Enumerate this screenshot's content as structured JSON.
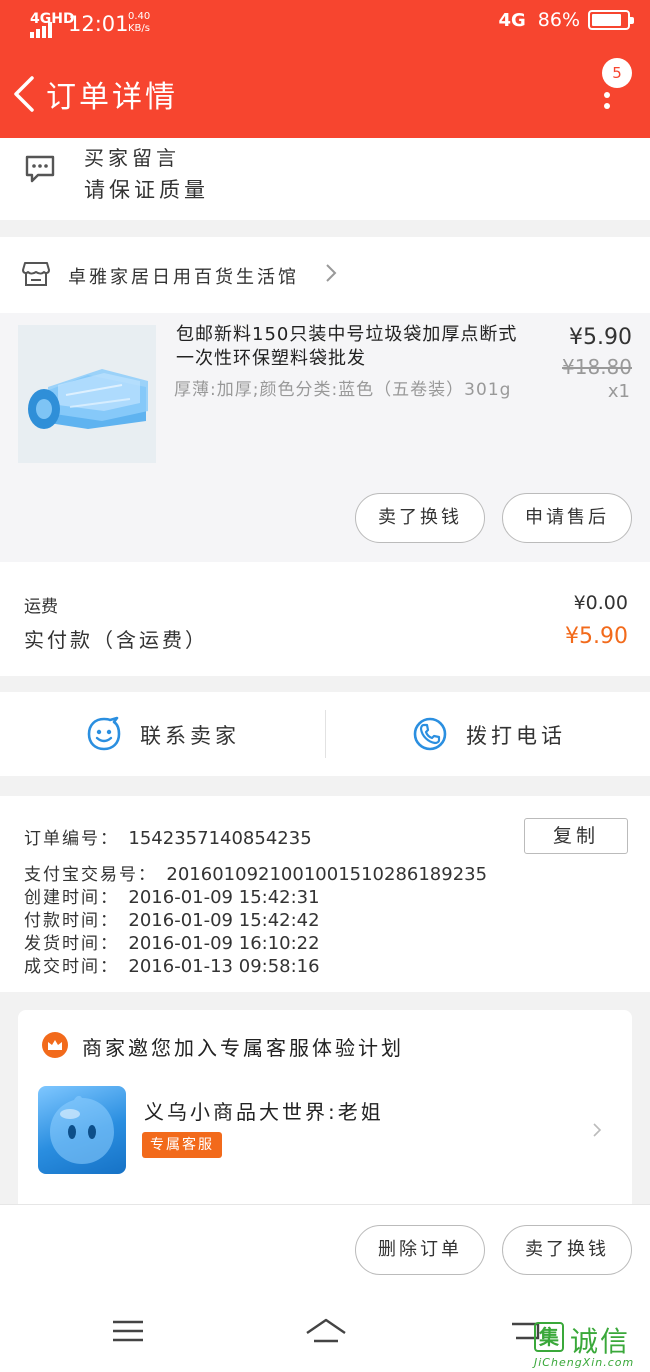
{
  "status_bar": {
    "network": "4GHD",
    "time": "12:01",
    "speed_value": "0.40",
    "speed_unit": "KB/s",
    "network_right": "4G",
    "battery_text": "86%",
    "battery_level": 0.86
  },
  "nav": {
    "title": "订单详情",
    "badge": "5"
  },
  "message": {
    "title": "买家留言",
    "body": "请保证质量"
  },
  "shop": {
    "name": "卓雅家居日用百货生活馆"
  },
  "item": {
    "title": "包邮新料150只装中号垃圾袋加厚点断式一次性环保塑料袋批发",
    "spec": "厚薄:加厚;颜色分类:蓝色（五卷装）301g",
    "price": "¥5.90",
    "original_price": "¥18.80",
    "quantity": "x1",
    "buttons": [
      "卖了换钱",
      "申请售后"
    ]
  },
  "fees": {
    "shipping_label": "运费",
    "shipping_value": "¥0.00",
    "paid_label": "实付款（含运费）",
    "paid_value": "¥5.90",
    "accent": "#f26a1b"
  },
  "contact": {
    "seller_label": "联系卖家",
    "phone_label": "拨打电话",
    "icon_color": "#2b8fe0"
  },
  "order_info": {
    "copy_label": "复制",
    "rows": [
      {
        "label": "订单编号：",
        "value": "1542357140854235"
      },
      {
        "label": "支付宝交易号：",
        "value": "2016010921001001510286189235"
      },
      {
        "label": "创建时间：",
        "value": "2016-01-09 15:42:31"
      },
      {
        "label": "付款时间：",
        "value": "2016-01-09 15:42:42"
      },
      {
        "label": "发货时间：",
        "value": "2016-01-09 16:10:22"
      },
      {
        "label": "成交时间：",
        "value": "2016-01-13 09:58:16"
      }
    ]
  },
  "service": {
    "title": "商家邀您加入专属客服体验计划",
    "name": "义乌小商品大世界:老姐",
    "tag": "专属客服"
  },
  "footer": {
    "buttons": [
      "删除订单",
      "卖了换钱"
    ]
  },
  "icons": {
    "back": "back-arrow-icon",
    "more": "more-vertical-icon",
    "message": "chat-bubble-icon",
    "shop": "shop-icon",
    "contact": "smiley-chat-icon",
    "phone": "phone-icon",
    "crown": "crown-icon",
    "menu": "menu-icon",
    "home": "home-icon",
    "return": "return-icon"
  },
  "watermark": {
    "chars": "诚信",
    "box_char": "集",
    "url": "JiChengXin.com"
  },
  "colors": {
    "brand": "#f7452f",
    "accent": "#f26a1b",
    "blue": "#2b8fe0"
  }
}
